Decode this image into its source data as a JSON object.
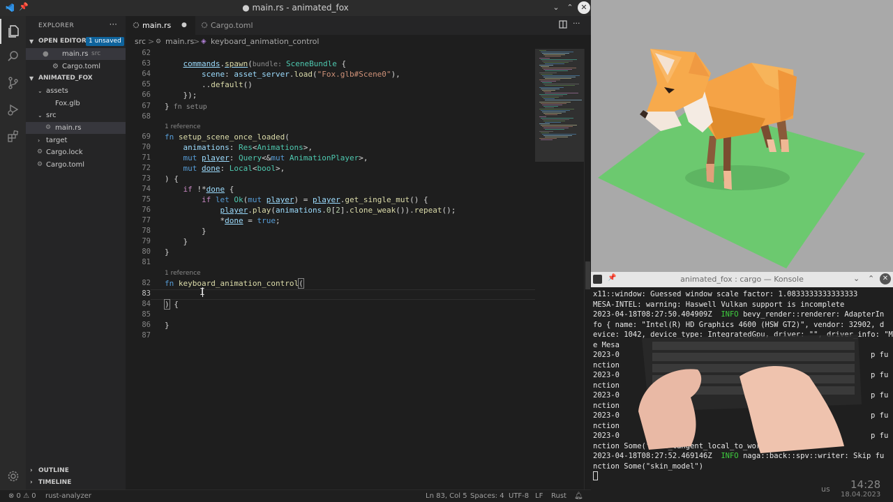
{
  "window": {
    "title": "● main.rs - animated_fox"
  },
  "explorer": {
    "header": "EXPLORER",
    "open_editors_label": "OPEN EDITORS",
    "unsaved_badge": "1 unsaved",
    "open_editors": [
      {
        "name": "main.rs",
        "detail": "src"
      },
      {
        "name": "Cargo.toml",
        "detail": ""
      }
    ],
    "project_label": "ANIMATED_FOX",
    "tree": {
      "assets": "assets",
      "fox": "Fox.glb",
      "src": "src",
      "main": "main.rs",
      "target": "target",
      "cargo_lock": "Cargo.lock",
      "cargo_toml": "Cargo.toml"
    },
    "outline_label": "OUTLINE",
    "timeline_label": "TIMELINE"
  },
  "tabs": [
    {
      "label": "main.rs"
    },
    {
      "label": "Cargo.toml"
    }
  ],
  "breadcrumb": {
    "part1": "src",
    "sep": ">",
    "part2": "main.rs",
    "part3": "keyboard_animation_control"
  },
  "editor": {
    "line_numbers": [
      "62",
      "63",
      "64",
      "65",
      "66",
      "67",
      "68",
      "69",
      "70",
      "71",
      "72",
      "73",
      "74",
      "75",
      "76",
      "77",
      "78",
      "79",
      "80",
      "81",
      "82",
      "83",
      "84",
      "85",
      "86",
      "87"
    ],
    "codelens_1": "1 reference",
    "codelens_2": "1 reference",
    "lines": {
      "l62": "",
      "l67a": "}",
      "l67b": " fn setup",
      "l82_fn": "fn ",
      "l82_name": "keyboard_animation_control",
      "l82_paren": "(",
      "l84": ") {",
      "l86": "}"
    }
  },
  "statusbar": {
    "problems": "⊗ 0 ⚠ 0",
    "analyzer": "rust-analyzer",
    "position": "Ln 83, Col 5",
    "spaces": "Spaces: 4",
    "encoding": "UTF-8",
    "eol": "LF",
    "language": "Rust"
  },
  "konsole": {
    "title": "animated_fox : cargo — Konsole",
    "lines": [
      "x11::window: Guessed window scale factor: 1.0833333333333333",
      "MESA-INTEL: warning: Haswell Vulkan support is incomplete",
      "2023-04-18T08:27:50.404909Z",
      "fo { name: \"Intel(R) HD Graphics 4600 (HSW GT2)\", vendor: 32902, d",
      "evice: 1042, device_type: IntegratedGpu, driver: \"\", driver_info: \"Mesa",
      "e Mesa",
      "2023-0",
      "nction",
      "2023-0",
      "nction",
      "2023-0",
      "nction",
      "2023-0",
      "nction",
      "2023-0",
      "nction Some(\"mesh_tangent_local_to_world\")",
      "2023-04-18T08:27:52.469146Z",
      "nction Some(\"skin_model\")"
    ],
    "info_label": "INFO",
    "line3_rest": " bevy_render::renderer: AdapterIn",
    "line17_rest": " naga::back::spv::writer: Skip fu",
    "right_frag": "p fu",
    "clock_time": "14:28",
    "clock_date": "18.04.2023",
    "kbd_layout": "us"
  }
}
